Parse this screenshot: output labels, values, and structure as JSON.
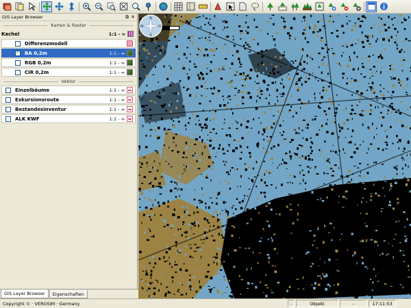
{
  "toolbar": {
    "buttons": [
      {
        "icon": "layers-red-icon"
      },
      {
        "icon": "pages-icon"
      },
      {
        "icon": "arrow-icon"
      },
      {
        "icon": "pan-icon",
        "active": true
      },
      {
        "icon": "move-icon"
      },
      {
        "icon": "vertical-move-icon"
      },
      {
        "icon": "zoom-in-icon"
      },
      {
        "icon": "zoom-out-icon"
      },
      {
        "icon": "zoom-box-icon"
      },
      {
        "icon": "zoom-full-icon"
      },
      {
        "icon": "magnifier-icon"
      },
      {
        "icon": "pin-icon"
      },
      {
        "icon": "globe-icon"
      },
      {
        "icon": "grid-icon"
      },
      {
        "icon": "table-icon"
      },
      {
        "icon": "measure-icon"
      },
      {
        "icon": "marker-icon"
      },
      {
        "icon": "select-icon"
      },
      {
        "icon": "document-icon"
      },
      {
        "icon": "lasso-icon"
      },
      {
        "icon": "tree-icon"
      },
      {
        "icon": "tree-table-icon"
      },
      {
        "icon": "trees-icon"
      },
      {
        "icon": "forest-icon"
      },
      {
        "icon": "tree-grid-icon"
      },
      {
        "icon": "tree-add-icon"
      },
      {
        "icon": "tree-remove-icon"
      },
      {
        "icon": "tree-settings-icon"
      },
      {
        "icon": "window-icon",
        "active": true
      },
      {
        "icon": "info-icon"
      }
    ]
  },
  "panel": {
    "title": "GIS Layer Browser",
    "controls": [
      "⧉",
      "✕"
    ],
    "groups": [
      {
        "label": "Karten & Raster",
        "header_row": {
          "label": "Kachel",
          "scale": "1:1 - ∞"
        },
        "rows": [
          {
            "label": "Differenzmodell",
            "scale": "",
            "checked": false,
            "selected": false,
            "icon": "pink"
          },
          {
            "label": "BA 0,2m",
            "scale": "1:1 - ∞",
            "checked": true,
            "selected": true,
            "icon": "img"
          },
          {
            "label": "RGB 0,2m",
            "scale": "1:1 - ∞",
            "checked": false,
            "selected": false,
            "icon": "img"
          },
          {
            "label": "CIR 0,2m",
            "scale": "1:1 - ∞",
            "checked": false,
            "selected": false,
            "icon": "img"
          }
        ]
      },
      {
        "label": "Vektor",
        "rows": [
          {
            "label": "Einzelbäume",
            "scale": "1:1 - ∞",
            "checked": false,
            "selected": false,
            "icon": "vec"
          },
          {
            "label": "Exkursionsroute",
            "scale": "1:1 - ∞",
            "checked": false,
            "selected": false,
            "icon": "vec"
          },
          {
            "label": "Bestandesinventur",
            "scale": "1:1 - ∞",
            "checked": false,
            "selected": false,
            "icon": "vec"
          },
          {
            "label": "ALK KWF",
            "scale": "1:1 - ∞",
            "checked": false,
            "selected": false,
            "icon": "vec"
          }
        ]
      }
    ],
    "tabs": [
      {
        "label": "GIS Layer Browser",
        "active": true
      },
      {
        "label": "Eigenschaften",
        "active": false
      }
    ]
  },
  "map": {
    "colors": {
      "water": "#73a6c6",
      "ground": "#9c8344",
      "shadow": "#000000"
    },
    "compass_letters": [
      "N",
      "O",
      "S",
      "W"
    ]
  },
  "status": {
    "copyright": "Copyright © · VEROSIM · Germany",
    "cells": [
      "-",
      "Objekt",
      "-",
      "17:11:53"
    ]
  }
}
